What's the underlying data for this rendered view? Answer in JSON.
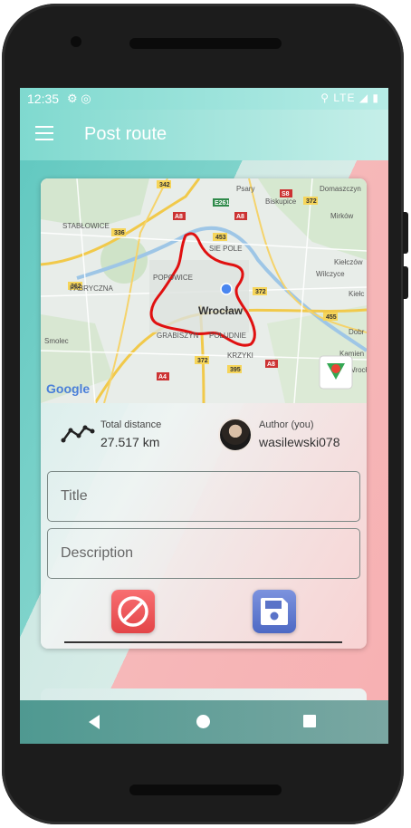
{
  "status_bar": {
    "time": "12:35",
    "network": "LTE"
  },
  "app_bar": {
    "title": "Post route"
  },
  "map": {
    "city_label": "Wrocław",
    "provider_logo": "Google",
    "place_labels": [
      "Psary",
      "Biskupice",
      "Domaszczyn",
      "Mirków",
      "STABŁOWICE",
      "SIE POLE",
      "Kiełczów",
      "FABRYCZNA",
      "Wilczyce",
      "POPOWICE",
      "Kiełc",
      "Smolec",
      "GRABISZYN",
      "POŁUDNIE",
      "KRZYKI",
      "Dobr",
      "Kamien",
      "Wrocł"
    ],
    "road_labels": [
      "342",
      "E261",
      "A8",
      "S8",
      "372",
      "336",
      "453",
      "362",
      "A4",
      "372",
      "455",
      "372",
      "395",
      "A8"
    ]
  },
  "stats": {
    "distance_label": "Total distance",
    "distance_value": "27.517 km",
    "author_label": "Author (you)",
    "author_value": "wasilewski078"
  },
  "form": {
    "title_placeholder": "Title",
    "description_placeholder": "Description"
  },
  "icons": {
    "menu": "menu-icon",
    "settings": "gear-icon",
    "location": "location-icon",
    "distance": "route-icon",
    "cancel": "block-icon",
    "save": "floppy-disk-icon"
  },
  "colors": {
    "teal_accent": "#7fd9cf",
    "cancel_button": "#e34548",
    "save_button": "#4e69c4",
    "route_line": "#e01010"
  }
}
